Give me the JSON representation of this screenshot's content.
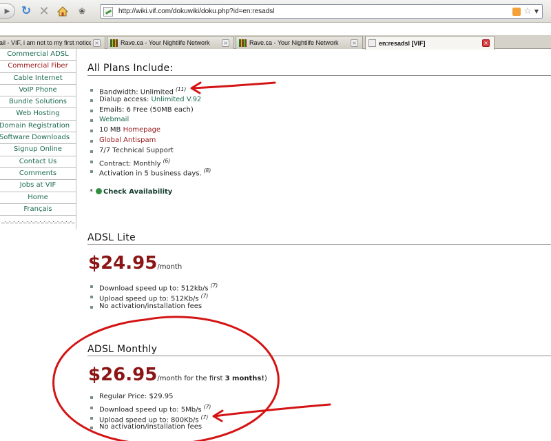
{
  "browser": {
    "url": "http://wiki.vif.com/dokuwiki/doku.php?id=en:resadsl",
    "tabs": [
      {
        "label": "ail - VIF, i am not to my first notice o...",
        "close": "×",
        "active": false
      },
      {
        "label": "Rave.ca - Your Nightlife Network",
        "close": "×",
        "active": false
      },
      {
        "label": "Rave.ca - Your Nightlife Network",
        "close": "×",
        "active": false
      },
      {
        "label": "en:resadsl [VIF]",
        "close": "×",
        "active": true
      }
    ]
  },
  "sidebar": {
    "items": [
      "Commercial ADSL",
      "Commercial Fiber",
      "Cable Internet",
      "VoIP Phone",
      "Bundle Solutions",
      "Web Hosting",
      "Domain Registration",
      "Software Downloads",
      "Signup Online",
      "Contact Us",
      "Comments",
      "Jobs at VIF",
      "Home",
      "Français"
    ],
    "dashes": "_._._._._._._._._._._._._._._._._"
  },
  "plans": {
    "title": "All Plans Include:",
    "bandwidth": "Bandwidth: Unlimited",
    "bandwidth_note": "(11)",
    "dialup_prefix": "Dialup access: ",
    "dialup_link": "Unlimited V.92",
    "emails": "Emails: 6 Free (50MB each)",
    "webmail": "Webmail",
    "homepage_prefix": "10 MB ",
    "homepage_link": "Homepage",
    "antispam": "Global Antispam",
    "support": "7/7 Technical Support",
    "contract": "Contract: Monthly",
    "contract_note": "(6)",
    "activation": "Activation in 5 business days.",
    "activation_note": "(8)",
    "check_prefix": "*",
    "check_link": "Check Availability"
  },
  "lite": {
    "title": "ADSL Lite",
    "price": "$24.95",
    "per": "/month",
    "download": "Download speed up to: 512kb/s",
    "download_note": "(7)",
    "upload": "Upload speed up to: 512Kb/s",
    "upload_note": "(7)",
    "fees": "No activation/installation fees"
  },
  "monthly": {
    "title": "ADSL Monthly",
    "price": "$26.95",
    "per": "/month for the first ",
    "per_bold": "3 months!",
    "per_end": ")",
    "regular": "Regular Price: $29.95",
    "download": "Download speed up to: 5Mb/s",
    "download_note": "(7)",
    "upload": "Upload speed up to: 800Kb/s",
    "upload_note": "(7)",
    "fees": "No activation/installation fees"
  },
  "annotation_color": "#d41414"
}
